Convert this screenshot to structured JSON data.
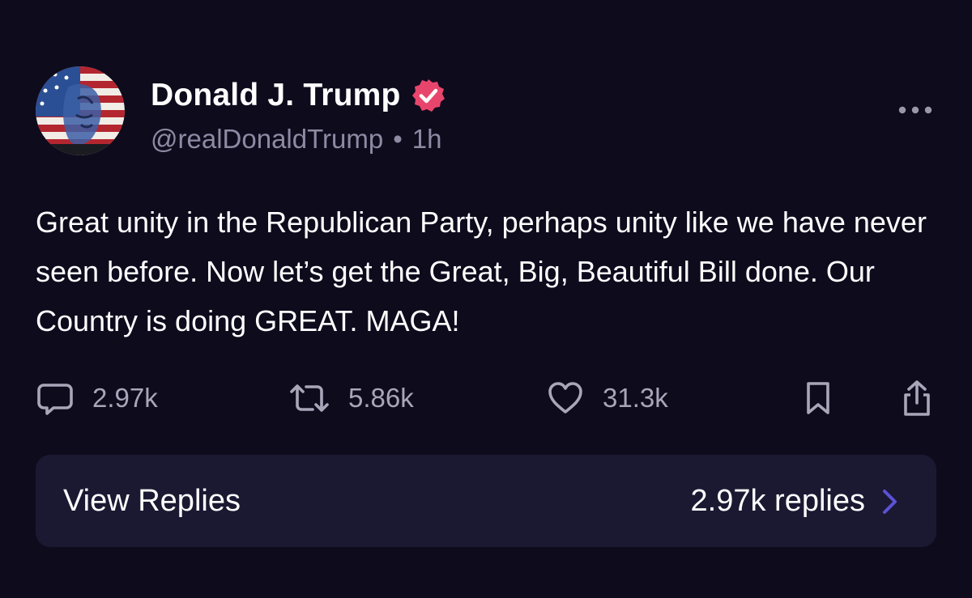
{
  "author": {
    "display_name": "Donald J. Trump",
    "handle": "@realDonaldTrump",
    "separator": "•",
    "time": "1h",
    "verified": true,
    "avatar_icon": "flag-portrait-avatar",
    "verified_badge_color": "#e8456d"
  },
  "post": {
    "text": "Great unity in the Republican Party, perhaps unity like we have never seen before. Now let’s get the Great, Big, Beautiful Bill done. Our Country is doing GREAT. MAGA!"
  },
  "actions": {
    "replies": "2.97k",
    "reposts": "5.86k",
    "likes": "31.3k",
    "icons": [
      "reply-icon",
      "repost-icon",
      "like-icon",
      "bookmark-icon",
      "share-icon"
    ]
  },
  "replies_bar": {
    "label": "View Replies",
    "count": "2.97k replies",
    "chevron_color": "#5b52d6"
  },
  "colors": {
    "background": "#0e0b1d",
    "card": "#1b1932",
    "muted_text": "#8e8aa3"
  }
}
